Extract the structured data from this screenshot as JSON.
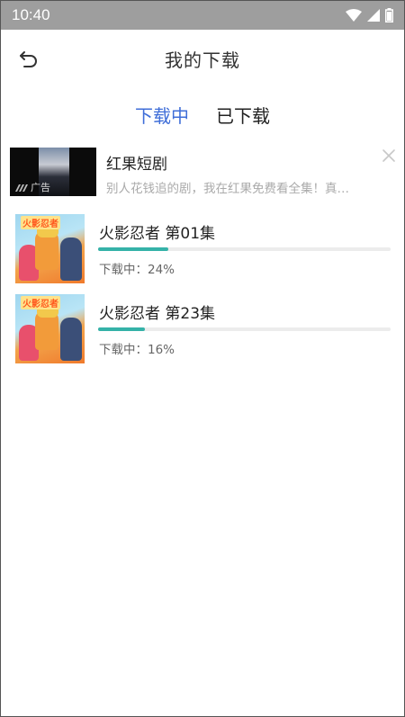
{
  "status_bar": {
    "time": "10:40"
  },
  "header": {
    "title": "我的下载"
  },
  "tabs": [
    {
      "label": "下载中",
      "active": true
    },
    {
      "label": "已下载",
      "active": false
    }
  ],
  "ad": {
    "title": "红果短剧",
    "description": "别人花钱追的剧，我在红果免费看全集！真…",
    "badge": "广告"
  },
  "downloads": [
    {
      "title": "火影忍者  第01集",
      "status": "下载中：24%",
      "progress": 0.24,
      "thumb_logo": "火影忍者"
    },
    {
      "title": "火影忍者  第23集",
      "status": "下载中：16%",
      "progress": 0.16,
      "thumb_logo": "火影忍者"
    }
  ],
  "colors": {
    "accent": "#3f6ed8",
    "progress": "#35b2a8",
    "status_bar": "#9e9e9e"
  },
  "icons": [
    "wifi-icon",
    "signal-icon",
    "battery-icon",
    "back-arrow-icon",
    "close-icon"
  ]
}
